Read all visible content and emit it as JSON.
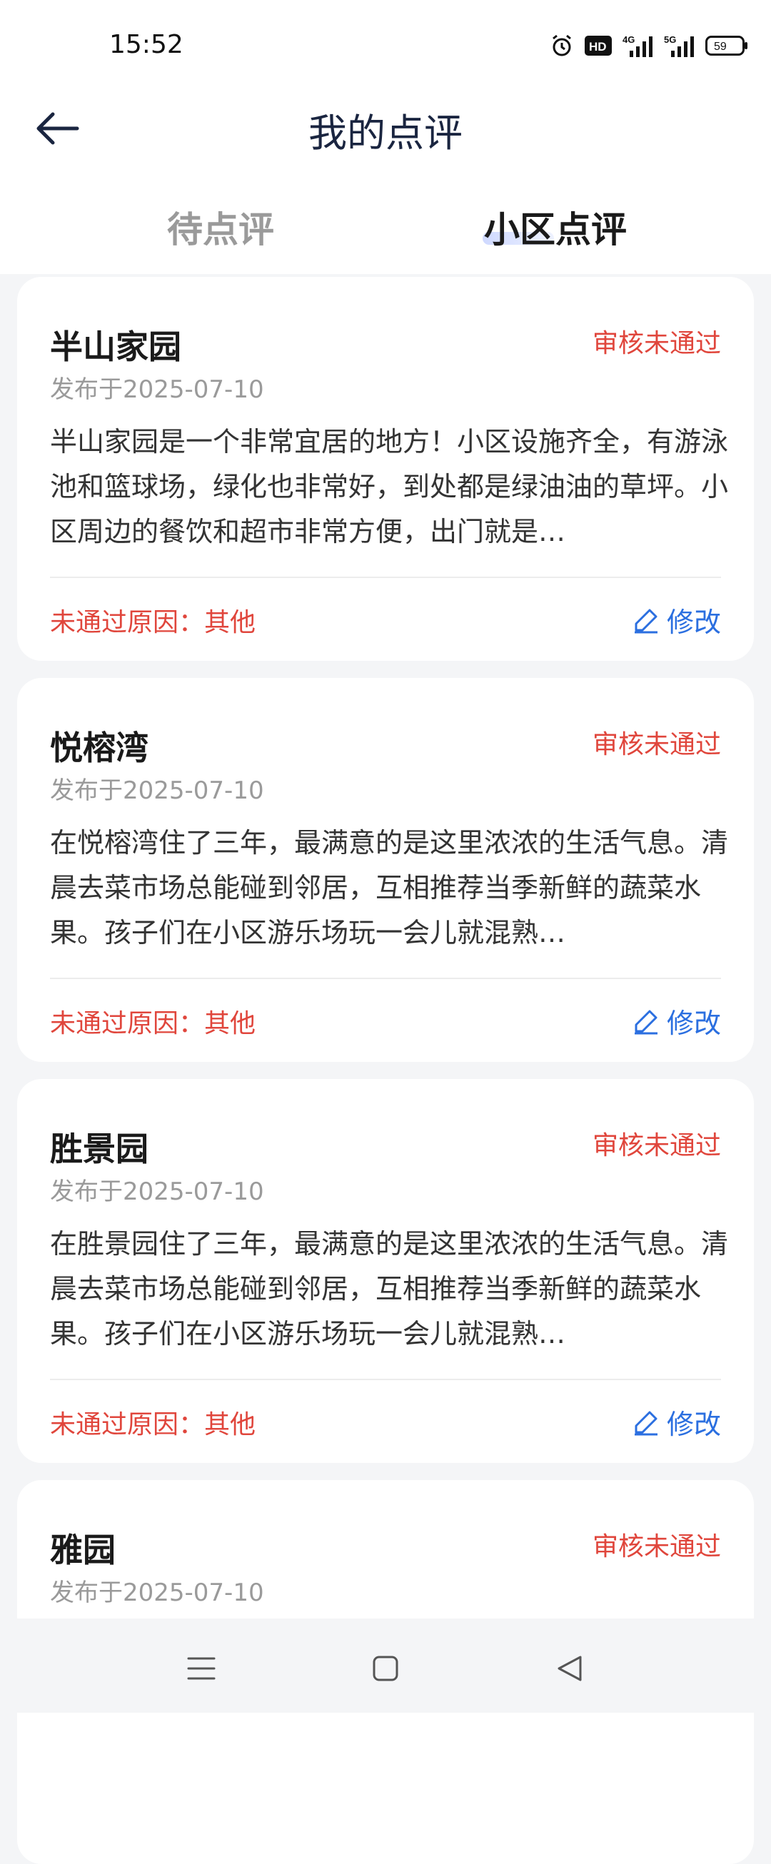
{
  "status_bar": {
    "time": "15:52",
    "hd_label": "HD",
    "net1": "4G",
    "net2": "5G",
    "battery": "59"
  },
  "header": {
    "title": "我的点评"
  },
  "tabs": [
    {
      "label": "待点评"
    },
    {
      "label": "小区点评"
    }
  ],
  "colors": {
    "accent_blue": "#2b6fe0",
    "status_red": "#e0463c"
  },
  "reviews": [
    {
      "community": "半山家园",
      "status": "审核未通过",
      "date": "发布于2025-07-10",
      "content": "半山家园是一个非常宜居的地方！小区设施齐全，有游泳池和篮球场，绿化也非常好，到处都是绿油油的草坪。小区周边的餐饮和超市非常方便，出门就是…",
      "reason": "未通过原因：其他",
      "edit_label": "修改"
    },
    {
      "community": "悦榕湾",
      "status": "审核未通过",
      "date": "发布于2025-07-10",
      "content": "在悦榕湾住了三年，最满意的是这里浓浓的生活气息。清晨去菜市场总能碰到邻居，互相推荐当季新鲜的蔬菜水果。孩子们在小区游乐场玩一会儿就混熟…",
      "reason": "未通过原因：其他",
      "edit_label": "修改"
    },
    {
      "community": "胜景园",
      "status": "审核未通过",
      "date": "发布于2025-07-10",
      "content": "在胜景园住了三年，最满意的是这里浓浓的生活气息。清晨去菜市场总能碰到邻居，互相推荐当季新鲜的蔬菜水果。孩子们在小区游乐场玩一会儿就混熟…",
      "reason": "未通过原因：其他",
      "edit_label": "修改"
    },
    {
      "community": "雅园",
      "status": "审核未通过",
      "date": "发布于2025-07-10"
    }
  ],
  "nav_bar": {
    "icons": [
      "menu-icon",
      "home-square-icon",
      "back-triangle-icon"
    ]
  }
}
